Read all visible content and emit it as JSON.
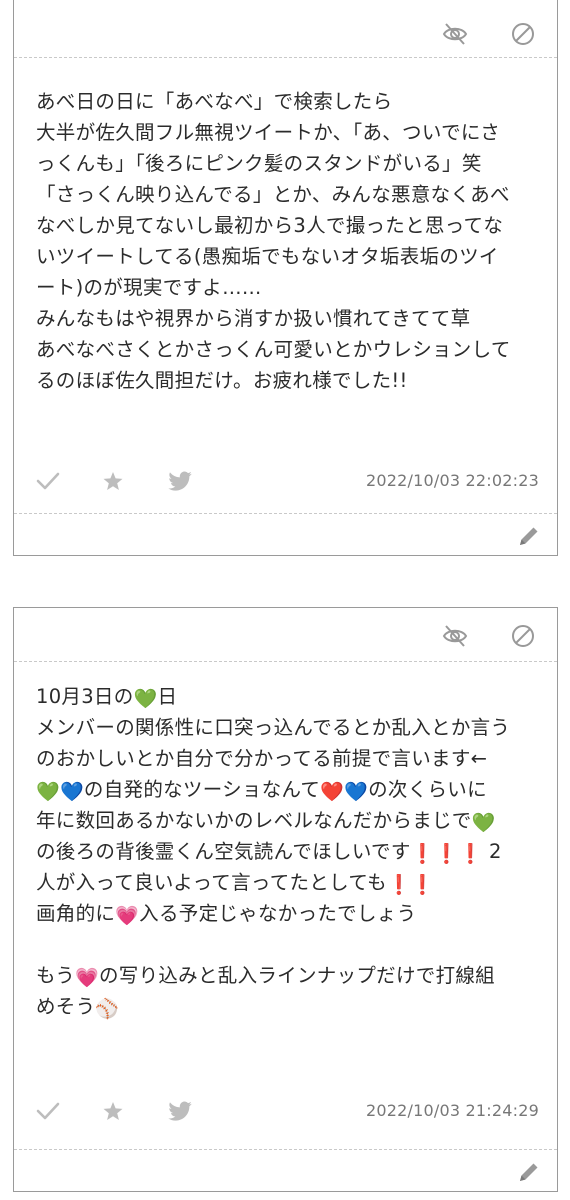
{
  "posts": [
    {
      "body_lines": [
        "あべ日の日に「あべなべ」で検索したら",
        "大半が佐久間フル無視ツイートか、「あ、ついでにさ",
        "っくんも」「後ろにピンク髪のスタンドがいる」笑",
        "「さっくん映り込んでる」とか、みんな悪意なくあべ",
        "なべしか見てないし最初から3人で撮ったと思ってな",
        "いツイートしてる(愚痴垢でもないオタ垢表垢のツイ",
        "ート)のが現実ですよ……",
        "みんなもはや視界から消すか扱い慣れてきてて草",
        "あべなべさくとかさっくん可愛いとかウレションして",
        "るのほぼ佐久間担だけ。お疲れ様でした!!"
      ],
      "timestamp": "2022/10/03 22:02:23"
    },
    {
      "body_segments": [
        [
          "10月3日の",
          "💚",
          "日"
        ],
        [
          "メンバーの関係性に口突っ込んでるとか乱入とか言う"
        ],
        [
          "のおかしいとか自分で分かってる前提で言います←"
        ],
        [
          "💚💙",
          "の自発的なツーショなんて",
          "❤️💙",
          "の次くらいに"
        ],
        [
          "年に数回あるかないかのレベルなんだからまじで",
          "💚"
        ],
        [
          "の後ろの背後霊くん空気読んでほしいです",
          "❗❗❗",
          " 2"
        ],
        [
          "人が入って良いよって言ってたとしても",
          "❗❗"
        ],
        [
          "画角的に",
          "💗",
          "入る予定じゃなかったでしょう"
        ],
        [
          ""
        ],
        [
          "もう",
          "💗",
          "の写り込みと乱入ラインナップだけで打線組"
        ],
        [
          "めそう",
          "⚾"
        ]
      ],
      "timestamp": "2022/10/03 21:24:29"
    }
  ],
  "icons": {
    "top": [
      "eye-off-icon",
      "ban-icon"
    ],
    "actions": [
      "check-icon",
      "star-icon",
      "twitter-bird-icon"
    ],
    "edit": "pencil-icon"
  },
  "colors": {
    "border": "#9a9a9a",
    "divider": "#c9c9c9",
    "icon_gray": "#b5b5b5",
    "timestamp": "#777777"
  }
}
